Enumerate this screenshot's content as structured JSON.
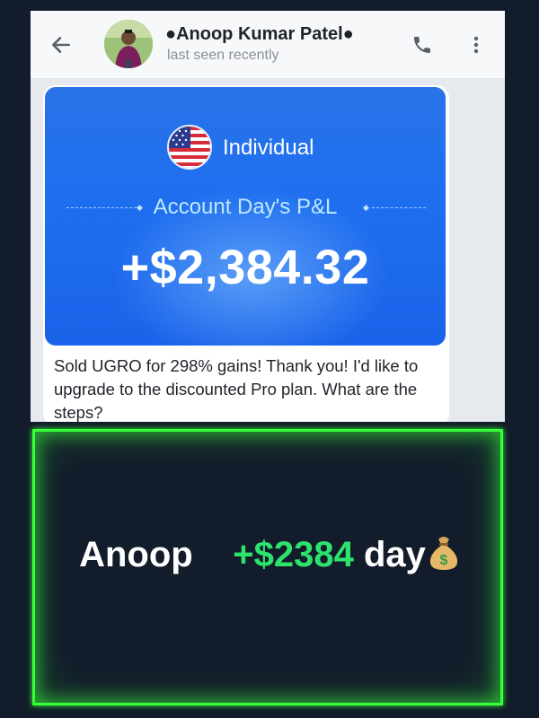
{
  "chat": {
    "contact_name": "●Anoop Kumar Patel●",
    "status": "last seen recently"
  },
  "pnl_card": {
    "account_type": "Individual",
    "label": "Account Day's P&L",
    "value": "+$2,384.32"
  },
  "message": {
    "text": "Sold UGRO for 298% gains! Thank you! I'd like to upgrade to the discounted Pro plan. What are the steps?"
  },
  "caption": {
    "name": "Anoop",
    "amount": "+$2384",
    "suffix": "day"
  },
  "colors": {
    "neon_border": "#39ff3a",
    "amount_green": "#2ee36b",
    "card_blue": "#1f6ff0",
    "page_bg": "#131c2b"
  },
  "icons": [
    "back-arrow-icon",
    "phone-icon",
    "more-vertical-icon",
    "us-flag-icon",
    "money-bag-icon"
  ]
}
